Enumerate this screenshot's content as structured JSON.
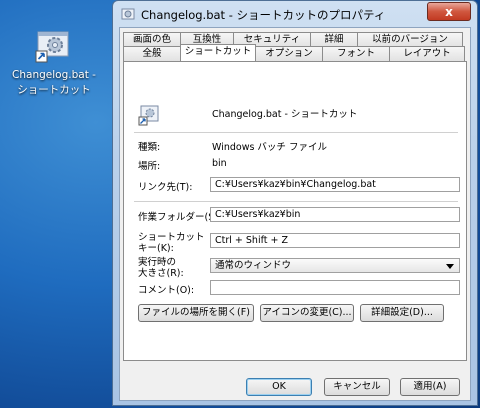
{
  "desktop_icon": {
    "label_line1": "Changelog.bat -",
    "label_line2": "ショートカット"
  },
  "window": {
    "title": "Changelog.bat - ショートカットのプロパティ",
    "close": "x"
  },
  "tabs_row1": [
    "画面の色",
    "互換性",
    "セキュリティ",
    "詳細",
    "以前のバージョン"
  ],
  "tabs_row2": [
    "全般",
    "ショートカット",
    "オプション",
    "フォント",
    "レイアウト"
  ],
  "shortcut": {
    "name": "Changelog.bat - ショートカット",
    "type_label": "種類:",
    "type_value": "Windows バッチ ファイル",
    "location_label": "場所:",
    "location_value": "bin",
    "target_label": "リンク先(T):",
    "target_value": "C:¥Users¥kaz¥bin¥Changelog.bat",
    "start_in_label": "作業フォルダー(S):",
    "start_in_value": "C:¥Users¥kaz¥bin",
    "hotkey_label_1": "ショートカット",
    "hotkey_label_2": "キー(K):",
    "hotkey_value": "Ctrl + Shift + Z",
    "run_label_1": "実行時の",
    "run_label_2": "大きさ(R):",
    "run_value": "通常のウィンドウ",
    "comment_label": "コメント(O):",
    "comment_value": ""
  },
  "panel_buttons": {
    "open_location": "ファイルの場所を開く(F)",
    "change_icon": "アイコンの変更(C)...",
    "advanced": "詳細設定(D)..."
  },
  "dialog_buttons": {
    "ok": "OK",
    "cancel": "キャンセル",
    "apply": "適用(A)"
  }
}
